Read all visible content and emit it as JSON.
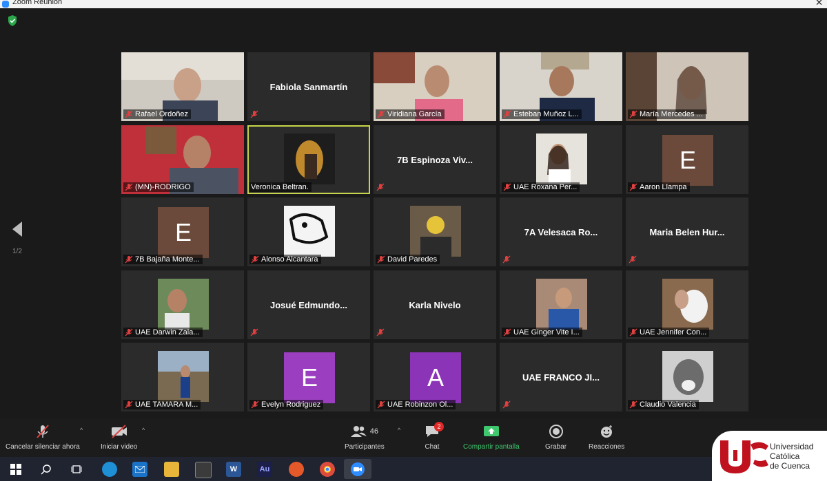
{
  "window": {
    "title": "Zoom Reunión"
  },
  "pager": {
    "page": "1/2"
  },
  "tiles": [
    {
      "name": "Rafael Ordoñez",
      "kind": "photo"
    },
    {
      "name": "Fabiola Sanmartín",
      "kind": "name"
    },
    {
      "name": "Viridiana García",
      "kind": "photo"
    },
    {
      "name": "Esteban Muñoz L...",
      "kind": "photo"
    },
    {
      "name": "María Mercedes ...",
      "kind": "photo"
    },
    {
      "name": "(MN)-RODRIGO",
      "kind": "photo"
    },
    {
      "name": "Veronica Beltran.",
      "kind": "pic"
    },
    {
      "name": "7B Espinoza Viv...",
      "kind": "name"
    },
    {
      "name": "UAE Roxana Per...",
      "kind": "pic"
    },
    {
      "name": "Aaron Llampa",
      "kind": "avatar",
      "letter": "E",
      "color": "#6b4a3c"
    },
    {
      "name": "7B Bajaña Monte...",
      "kind": "avatar",
      "letter": "E",
      "color": "#6b4a3c"
    },
    {
      "name": "Alonso Alcantara",
      "kind": "pic"
    },
    {
      "name": "David Paredes",
      "kind": "pic"
    },
    {
      "name": "7A Velesaca Ro...",
      "kind": "name"
    },
    {
      "name": "Maria Belen Hur...",
      "kind": "name"
    },
    {
      "name": "UAE Darwin Zala...",
      "kind": "pic"
    },
    {
      "name": "Josué Edmundo...",
      "kind": "name"
    },
    {
      "name": "Karla Nivelo",
      "kind": "name"
    },
    {
      "name": "UAE Ginger Vite I...",
      "kind": "pic"
    },
    {
      "name": "UAE Jennifer Con...",
      "kind": "pic"
    },
    {
      "name": "UAE TAMARA M...",
      "kind": "pic"
    },
    {
      "name": "Evelyn Rodriguez",
      "kind": "avatar",
      "letter": "E",
      "color": "#9b3fc0"
    },
    {
      "name": "UAE Robinzon Ol...",
      "kind": "avatar",
      "letter": "A",
      "color": "#8c34b8"
    },
    {
      "name": "UAE FRANCO JI...",
      "kind": "name"
    },
    {
      "name": "Claudio Valencia",
      "kind": "pic"
    }
  ],
  "toolbar": {
    "mute_label": "Cancelar silenciar ahora",
    "video_label": "Iniciar video",
    "participants_label": "Participantes",
    "participants_count": "46",
    "chat_label": "Chat",
    "chat_badge": "2",
    "share_label": "Compartir pantalla",
    "record_label": "Grabar",
    "reactions_label": "Reacciones"
  },
  "taskbar": {
    "word_label": "W",
    "audition_label": "Au"
  },
  "logo": {
    "line1": "Universidad",
    "line2": "Católica",
    "line3": "de Cuenca"
  },
  "colors": {
    "share_green": "#3ec76c",
    "active_speaker": "#c8d44b",
    "badge_red": "#e02828"
  }
}
